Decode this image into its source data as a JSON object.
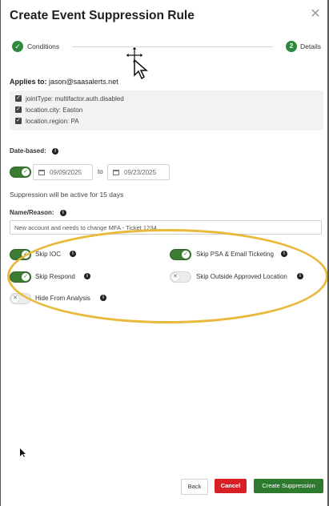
{
  "dialog": {
    "title": "Create Event Suppression Rule",
    "close_icon": "close-icon"
  },
  "stepper": {
    "step1_label": "Conditions",
    "step2_number": "2",
    "step2_label": "Details"
  },
  "applies_to": {
    "label": "Applies to:",
    "value": "jason@saasalerts.net",
    "conditions": [
      "jointType: multifactor.auth.disabled",
      "location.city: Easton",
      "location.region: PA"
    ]
  },
  "date_based": {
    "label": "Date-based:",
    "enabled": true,
    "start_date": "09/09/2025",
    "to_label": "to",
    "end_date": "09/23/2025",
    "active_text": "Suppression will be active for 15 days"
  },
  "reason": {
    "label": "Name/Reason:",
    "value": "New account and needs to change MFA - Ticket 1234"
  },
  "options": {
    "skip_ioc": {
      "label": "Skip IOC",
      "enabled": true
    },
    "skip_psa": {
      "label": "Skip PSA & Email Ticketing",
      "enabled": true
    },
    "skip_respond": {
      "label": "Skip Respond",
      "enabled": true
    },
    "skip_outside": {
      "label": "Skip Outside Approved Location",
      "enabled": false
    },
    "hide_analysis": {
      "label": "Hide From Analysis",
      "enabled": false
    }
  },
  "footer": {
    "back_label": "Back",
    "cancel_label": "Cancel",
    "create_label": "Create Suppression"
  },
  "colors": {
    "primary_green": "#2d7a2f",
    "cancel_red": "#d91f26",
    "highlight": "#e8b93a"
  }
}
